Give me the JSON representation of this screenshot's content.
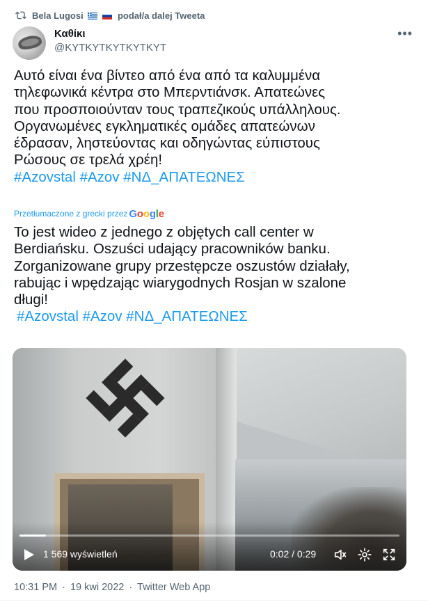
{
  "retweet": {
    "icon": "retweet-icon",
    "user": "Bela Lugosi",
    "flags": [
      "greece-flag",
      "russia-flag"
    ],
    "suffix": "podał/a dalej Tweeta"
  },
  "author": {
    "display_name": "Καθίκι",
    "handle": "@KYTKYTKYTKYTKYT"
  },
  "more_icon": "more-icon",
  "tweet": {
    "greek_text": "Αυτό είναι ένα βίντεο από ένα από τα καλυμμένα\nτηλεφωνικά κέντρα στο Μπερντιάνσκ. Απατεώνες\nπου προσποιούνταν τους τραπεζικούς υπάλληλους.\nΟργανωμένες εγκληματικές ομάδες απατεώνων\nέδρασαν, ληστεύοντας και οδηγώντας εύπιστους\nΡώσους σε τρελά χρέη!",
    "greek_hashtags": "#Azovstal #Azov #ΝΔ_ΑΠΑΤΕΩΝΕΣ",
    "translated_label": "Przetłumaczone z grecki przez",
    "translator": "Google",
    "polish_text": "To jest wideo z jednego z objętych call center w\nBerdiańsku. Oszuści udający pracowników banku.\n Zorganizowane grupy przestępcze oszustów działały,\nrabując i wpędzając wiarygodnych Rosjan w szalone\ndługi!",
    "polish_hashtags": "#Azovstal #Azov #ΝΔ_ΑΠΑΤΕΩΝΕΣ"
  },
  "video": {
    "views": "1 569 wyświetleń",
    "time": "0:02 / 0:29",
    "progress": 0.069,
    "controls": [
      "play-icon",
      "volume-icon",
      "settings-icon",
      "fullscreen-icon"
    ]
  },
  "footer": {
    "time": "10:31 PM",
    "date": "19 kwi 2022",
    "client": "Twitter Web App",
    "separator": "·"
  },
  "colors": {
    "link": "#1d9bf0",
    "secondary": "#536471",
    "text": "#0f1419"
  }
}
